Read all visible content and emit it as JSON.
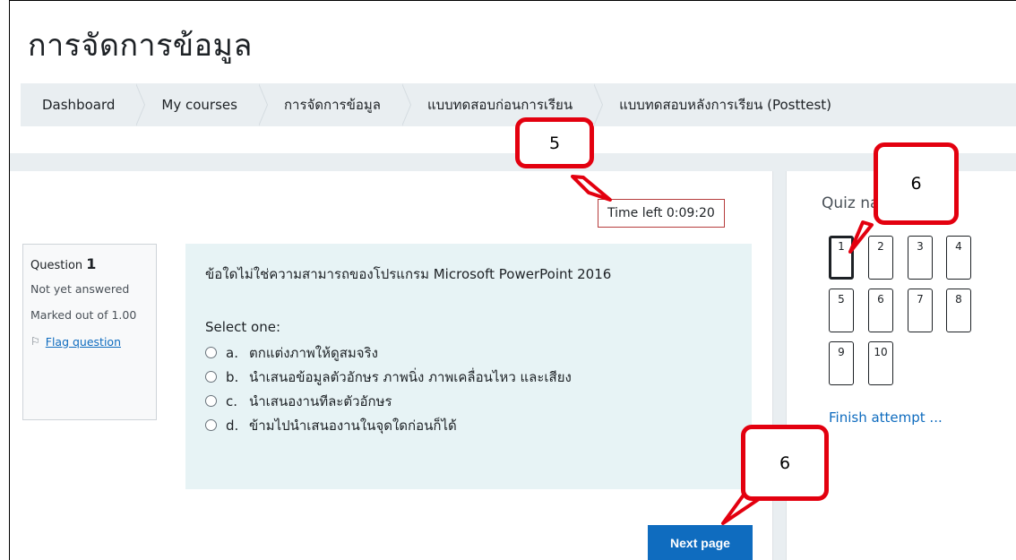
{
  "page": {
    "title": "การจัดการข้อมูล"
  },
  "breadcrumb": [
    {
      "label": "Dashboard"
    },
    {
      "label": "My courses"
    },
    {
      "label": "การจัดการข้อมูล"
    },
    {
      "label": "แบบทดสอบก่อนการเรียน"
    },
    {
      "label": "แบบทดสอบหลังการเรียน (Posttest)"
    }
  ],
  "timer": {
    "text": "Time left 0:09:20"
  },
  "question_info": {
    "label": "Question",
    "number": "1",
    "status": "Not yet answered",
    "marked": "Marked out of 1.00",
    "flag_label": "Flag question"
  },
  "question": {
    "text": "ข้อใดไม่ใช่ความสามารถของโปรแกรม Microsoft PowerPoint 2016",
    "prompt": "Select one:",
    "options": [
      {
        "letter": "a.",
        "text": "ตกแต่งภาพให้ดูสมจริง"
      },
      {
        "letter": "b.",
        "text": "นำเสนอข้อมูลตัวอักษร ภาพนิ่ง ภาพเคลื่อนไหว และเสียง"
      },
      {
        "letter": "c.",
        "text": "นำเสนองานทีละตัวอักษร"
      },
      {
        "letter": "d.",
        "text": "ข้ามไปนำเสนองานในจุดใดก่อนก็ได้"
      }
    ]
  },
  "next_button": {
    "label": "Next page"
  },
  "quiz_nav": {
    "title": "Quiz navigation",
    "numbers": [
      "1",
      "2",
      "3",
      "4",
      "5",
      "6",
      "7",
      "8",
      "9",
      "10"
    ],
    "current": "1",
    "finish_label": "Finish attempt ..."
  },
  "callouts": [
    {
      "label": "5"
    },
    {
      "label": "6"
    },
    {
      "label": "6"
    }
  ],
  "colors": {
    "accent": "#0f6cbf",
    "callout_border": "#e3000f",
    "timer_border": "#b63c3c",
    "question_bg": "#e7f3f5",
    "page_band": "#e9eef1"
  }
}
